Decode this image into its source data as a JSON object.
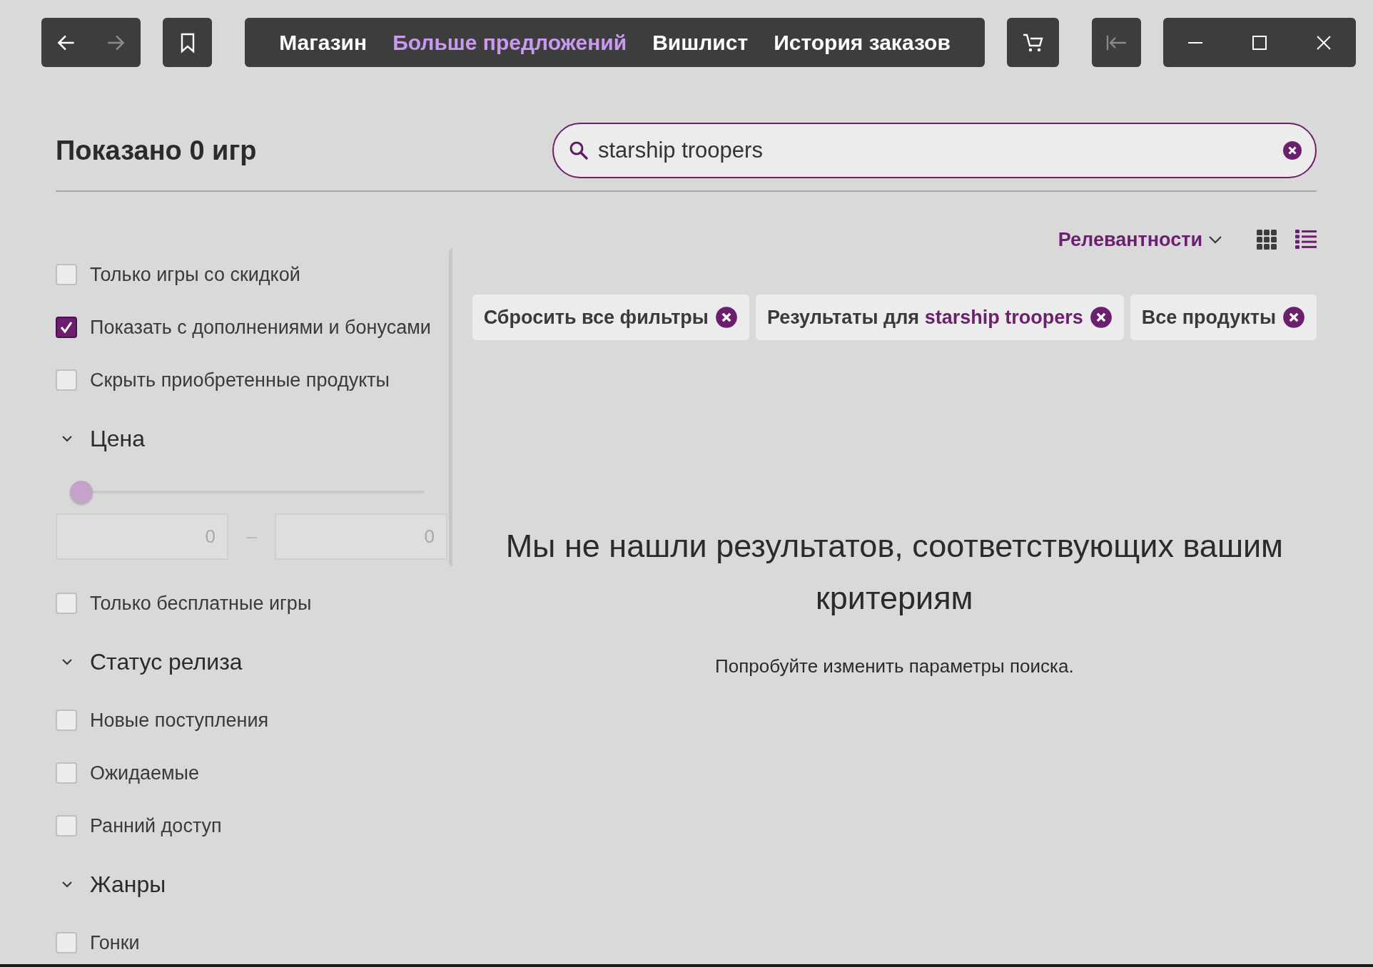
{
  "nav": {
    "back": {
      "disabled": false
    },
    "forward": {
      "disabled": true
    },
    "logout": {
      "disabled": true
    }
  },
  "tabs": [
    {
      "label": "Магазин",
      "selected": false
    },
    {
      "label": "Больше предложений",
      "selected": true
    },
    {
      "label": "Вишлист",
      "selected": false
    },
    {
      "label": "История заказов",
      "selected": false
    }
  ],
  "header": {
    "title": "Показано 0 игр"
  },
  "search": {
    "value": "starship troopers"
  },
  "sidebar": [
    {
      "kind": "checkbox",
      "label": "Только игры со скидкой",
      "checked": false
    },
    {
      "kind": "checkbox",
      "label": "Показать с дополнениями и бонусами",
      "checked": true
    },
    {
      "kind": "checkbox",
      "label": "Скрыть приобретенные продукты",
      "checked": false
    },
    {
      "kind": "section",
      "title": "Цена",
      "expanded": true,
      "children": [
        {
          "kind": "range",
          "level": 0,
          "min": "0",
          "separator": "–",
          "max": "0"
        },
        {
          "kind": "checkbox",
          "label": "Только бесплатные игры",
          "checked": false
        }
      ]
    },
    {
      "kind": "section",
      "title": "Статус релиза",
      "expanded": true,
      "children": [
        {
          "kind": "checkbox",
          "label": "Новые поступления",
          "checked": false
        },
        {
          "kind": "checkbox",
          "label": "Ожидаемые",
          "checked": false
        },
        {
          "kind": "checkbox",
          "label": "Ранний доступ",
          "checked": false
        }
      ]
    },
    {
      "kind": "section",
      "title": "Жанры",
      "expanded": true,
      "children": [
        {
          "kind": "checkbox",
          "label": "Гонки",
          "checked": false
        }
      ]
    }
  ],
  "sort": {
    "label": "Релевантности"
  },
  "views": [
    {
      "kind": "grid",
      "selected": false
    },
    {
      "kind": "list",
      "selected": true
    }
  ],
  "chips": [
    {
      "label": "Сбросить все фильтры"
    },
    {
      "label": "Результаты для",
      "query": "starship troopers"
    },
    {
      "label": "Все продукты"
    }
  ],
  "empty": {
    "title": "Мы не нашли результатов, соответствующих вашим критериям",
    "hint": "Попробуйте изменить параметры поиска."
  }
}
